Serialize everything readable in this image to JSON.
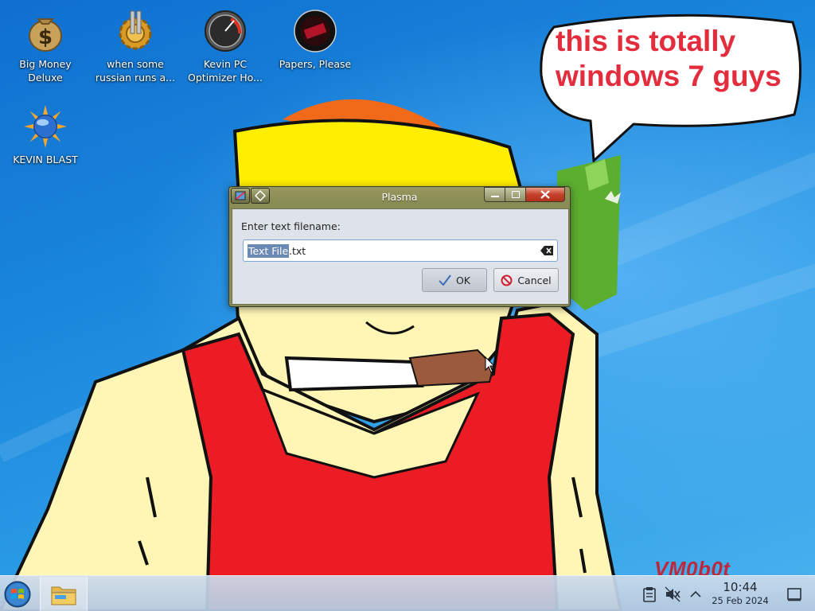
{
  "desktop": {
    "icons": [
      {
        "label": "Big Money Deluxe",
        "icon": "money-bag-icon"
      },
      {
        "label": "when some russian runs a...",
        "icon": "gear-icon"
      },
      {
        "label": "Kevin PC Optimizer Ho...",
        "icon": "speedometer-icon"
      },
      {
        "label": "Papers, Please",
        "icon": "papers-please-icon"
      },
      {
        "label": "KEVIN BLAST",
        "icon": "sun-globe-icon"
      }
    ],
    "speech_bubble": "this is totally windows 7 guys",
    "watermark": "VM0b0t"
  },
  "dialog": {
    "title": "Plasma",
    "prompt": "Enter text filename:",
    "filename_selected": "Text File",
    "filename_rest": ".txt",
    "ok_label": "OK",
    "cancel_label": "Cancel"
  },
  "taskbar": {
    "time": "10:44",
    "date": "25 Feb 2024",
    "tray_icons": [
      "clipboard-icon",
      "volume-muted-icon",
      "chevron-up-icon",
      "show-desktop-icon"
    ]
  },
  "colors": {
    "bubble_text": "#e32c3c",
    "dialog_frame": "#8a8c55",
    "selection": "#6b8ab3"
  }
}
